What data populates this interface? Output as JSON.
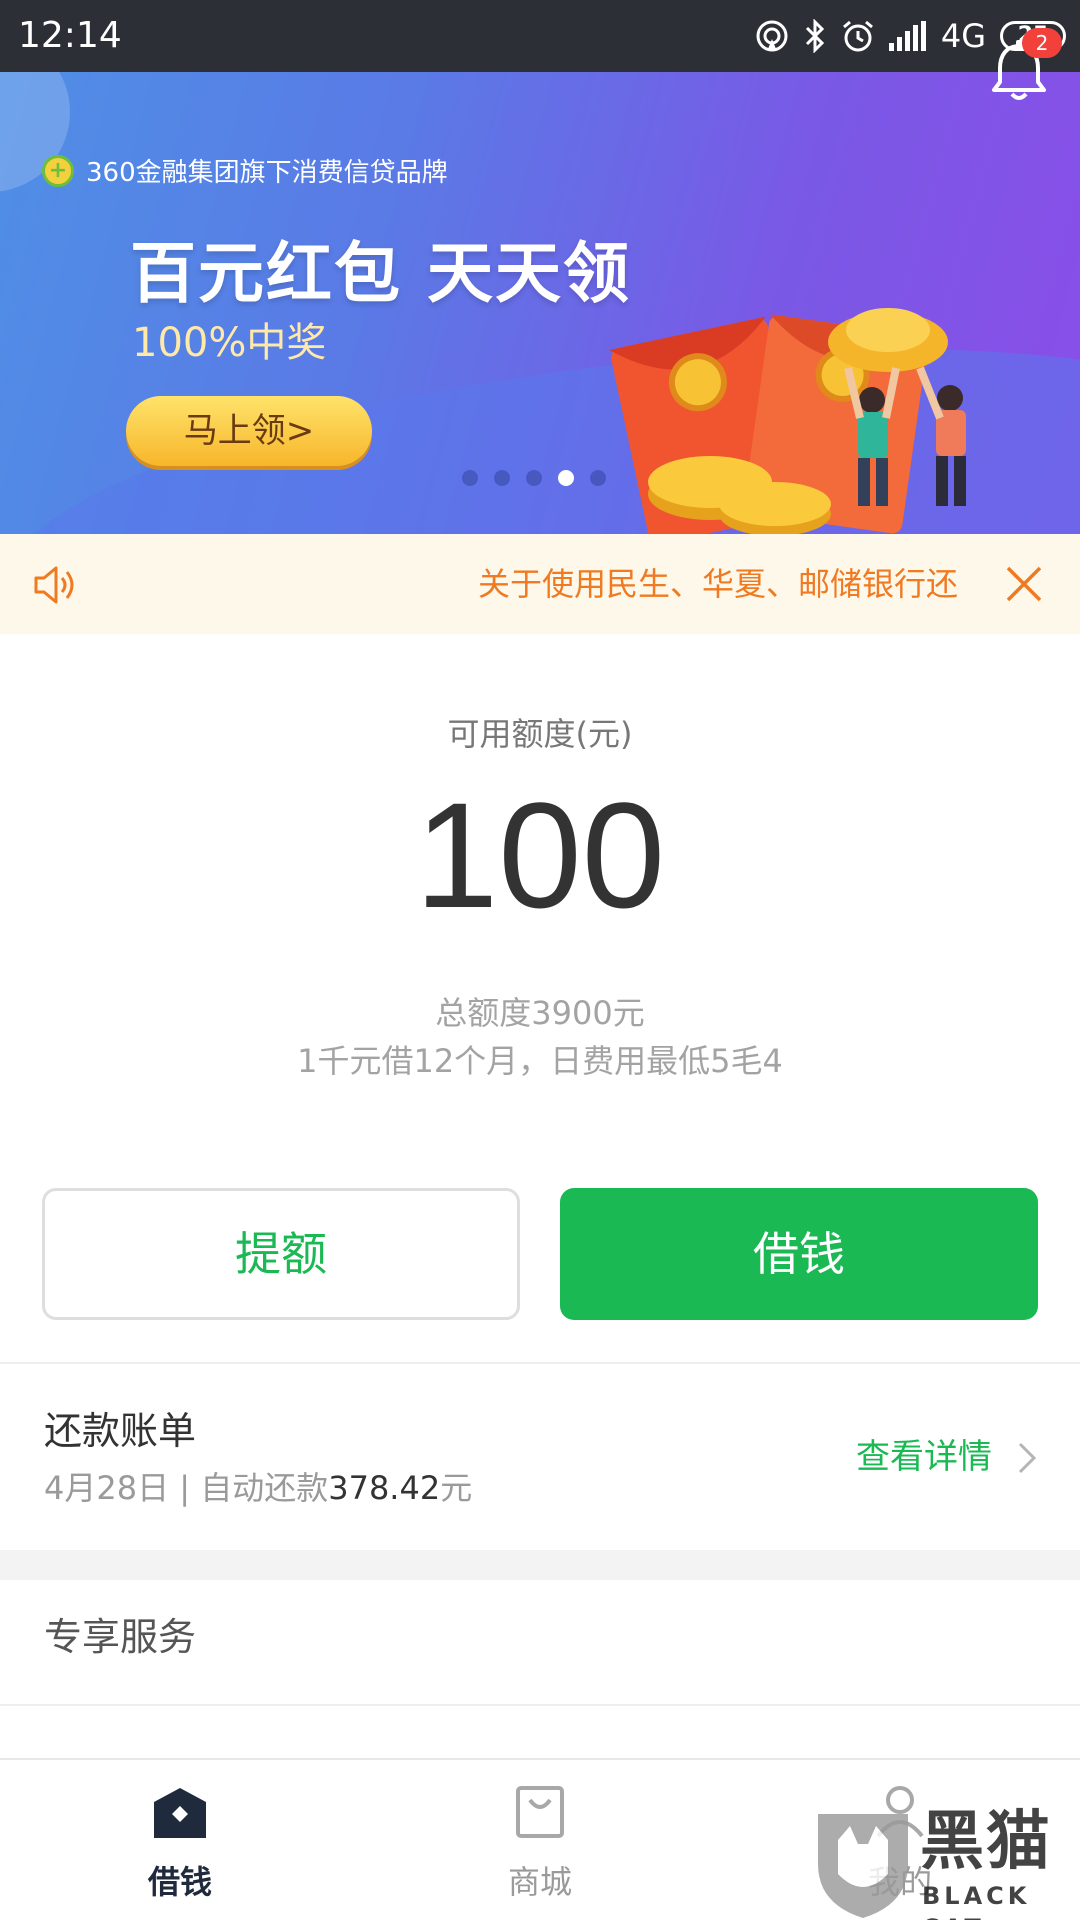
{
  "status_bar": {
    "time": "12:14",
    "network": "4G",
    "battery": "25"
  },
  "banner": {
    "brand": "360金融集团旗下消费信贷品牌",
    "title": "百元红包 天天领",
    "subtitle": "100%中奖",
    "cta": "马上领>",
    "notification_count": "2",
    "slide_count": 5,
    "active_slide": 4
  },
  "notice": {
    "text": "关于使用民生、华夏、邮储银行还"
  },
  "credit": {
    "label": "可用额度(元)",
    "amount": "100",
    "total": "总额度3900元",
    "tip": "1千元借12个月，日费用最低5毛4",
    "raise_label": "提额",
    "borrow_label": "借钱"
  },
  "bill": {
    "title": "还款账单",
    "detail_prefix": "4月28日 | 自动还款",
    "amount": "378.42",
    "unit": "元",
    "link": "查看详情"
  },
  "services": {
    "title": "专享服务"
  },
  "tabs": [
    {
      "label": "借钱",
      "icon": "home-icon",
      "active": true
    },
    {
      "label": "商城",
      "icon": "shopping-bag-icon",
      "active": false
    },
    {
      "label": "我的",
      "icon": "user-icon",
      "active": false
    }
  ],
  "watermark": {
    "text": "黑猫",
    "sub": "BLACK CAT"
  },
  "colors": {
    "accent": "#1bb954",
    "notice_text": "#f07a22",
    "notice_bg": "#fdf8e9",
    "status_bar": "#2c2f35",
    "badge": "#f2413a"
  }
}
